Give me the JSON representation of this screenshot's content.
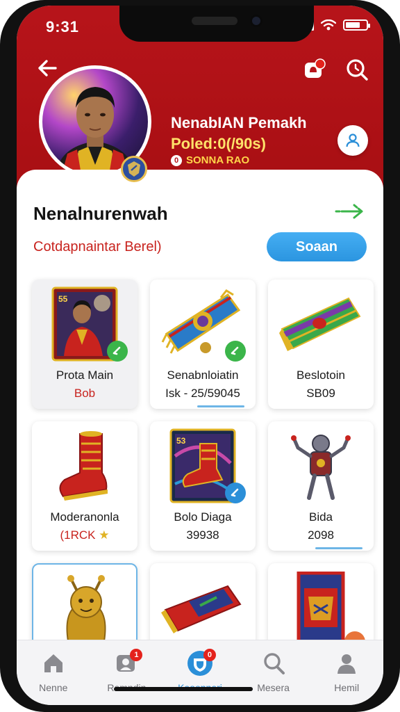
{
  "status_bar": {
    "time": "9:31"
  },
  "header": {
    "profile_name": "NenabIAN Pemakh",
    "profile_sub": "Poled:0(/90s)",
    "profile_id": "SONNA RAO",
    "id_icon_text": "0"
  },
  "section": {
    "title": "Nenalnurenwah",
    "subtitle": "Cotdapnaintar Berel)",
    "scan_label": "Soaan"
  },
  "items": [
    {
      "name": "Prota Main",
      "price": "Bob",
      "icon": "player-card-icon",
      "price_style": "red",
      "check_color": "#3bb54a"
    },
    {
      "name": "Senabnloiatin",
      "price": "Isk - 25/59045",
      "icon": "scarf-icon",
      "check_color": "#3bb54a"
    },
    {
      "name": "Beslotoin",
      "price": "SB09",
      "icon": "wristband-icon"
    },
    {
      "name": "Moderanonla",
      "price": "(1RCK",
      "icon": "boot-icon",
      "price_style": "red"
    },
    {
      "name": "Bolo Diaga",
      "price": "39938",
      "icon": "boot-card-icon",
      "check_color": "#2b8fd8"
    },
    {
      "name": "Bida",
      "price": "2098",
      "icon": "robot-figure-icon"
    },
    {
      "name": "",
      "price": "",
      "icon": "golden-mascot-icon"
    },
    {
      "name": "",
      "price": "",
      "icon": "folded-scarf-icon"
    },
    {
      "name": "",
      "price": "",
      "icon": "jersey-card-icon"
    }
  ],
  "bottom_nav": [
    {
      "label": "Nenne",
      "icon": "home-icon"
    },
    {
      "label": "Remndin",
      "icon": "reminder-icon",
      "badge": "1"
    },
    {
      "label": "Keoonneri",
      "icon": "shield-icon",
      "badge": "0",
      "active": true
    },
    {
      "label": "Mesera",
      "icon": "search-icon"
    },
    {
      "label": "Hemil",
      "icon": "profile-icon"
    }
  ],
  "colors": {
    "brand_red": "#b7141a",
    "accent_blue": "#2b95e0",
    "check_green": "#3bb54a"
  }
}
